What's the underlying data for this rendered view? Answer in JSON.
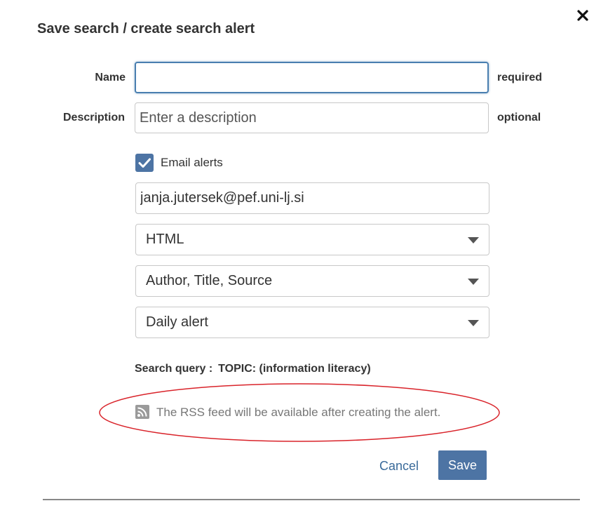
{
  "dialog": {
    "title": "Save search / create search alert"
  },
  "form": {
    "name": {
      "label": "Name",
      "value": "",
      "placeholder": "",
      "hint": "required"
    },
    "description": {
      "label": "Description",
      "value": "",
      "placeholder": "Enter a description",
      "hint": "optional"
    },
    "email_alerts": {
      "label": "Email alerts",
      "checked": true
    },
    "email": {
      "value": "janja.jutersek@pef.uni-lj.si"
    },
    "format_select": {
      "selected": "HTML"
    },
    "content_select": {
      "selected": "Author, Title, Source"
    },
    "frequency_select": {
      "selected": "Daily alert"
    },
    "search_query": {
      "label": "Search query :",
      "value": "TOPIC: (information literacy)"
    },
    "rss": {
      "icon": "rss-icon",
      "message": "The RSS feed will be available after creating the alert."
    }
  },
  "actions": {
    "cancel_label": "Cancel",
    "save_label": "Save"
  },
  "colors": {
    "accent": "#4d74a4",
    "link": "#3a6a9a",
    "annotation_ellipse": "#d9232a"
  },
  "icons": {
    "close": "close-icon",
    "checkbox": "checkmark-icon",
    "dropdown": "chevron-down-icon"
  }
}
